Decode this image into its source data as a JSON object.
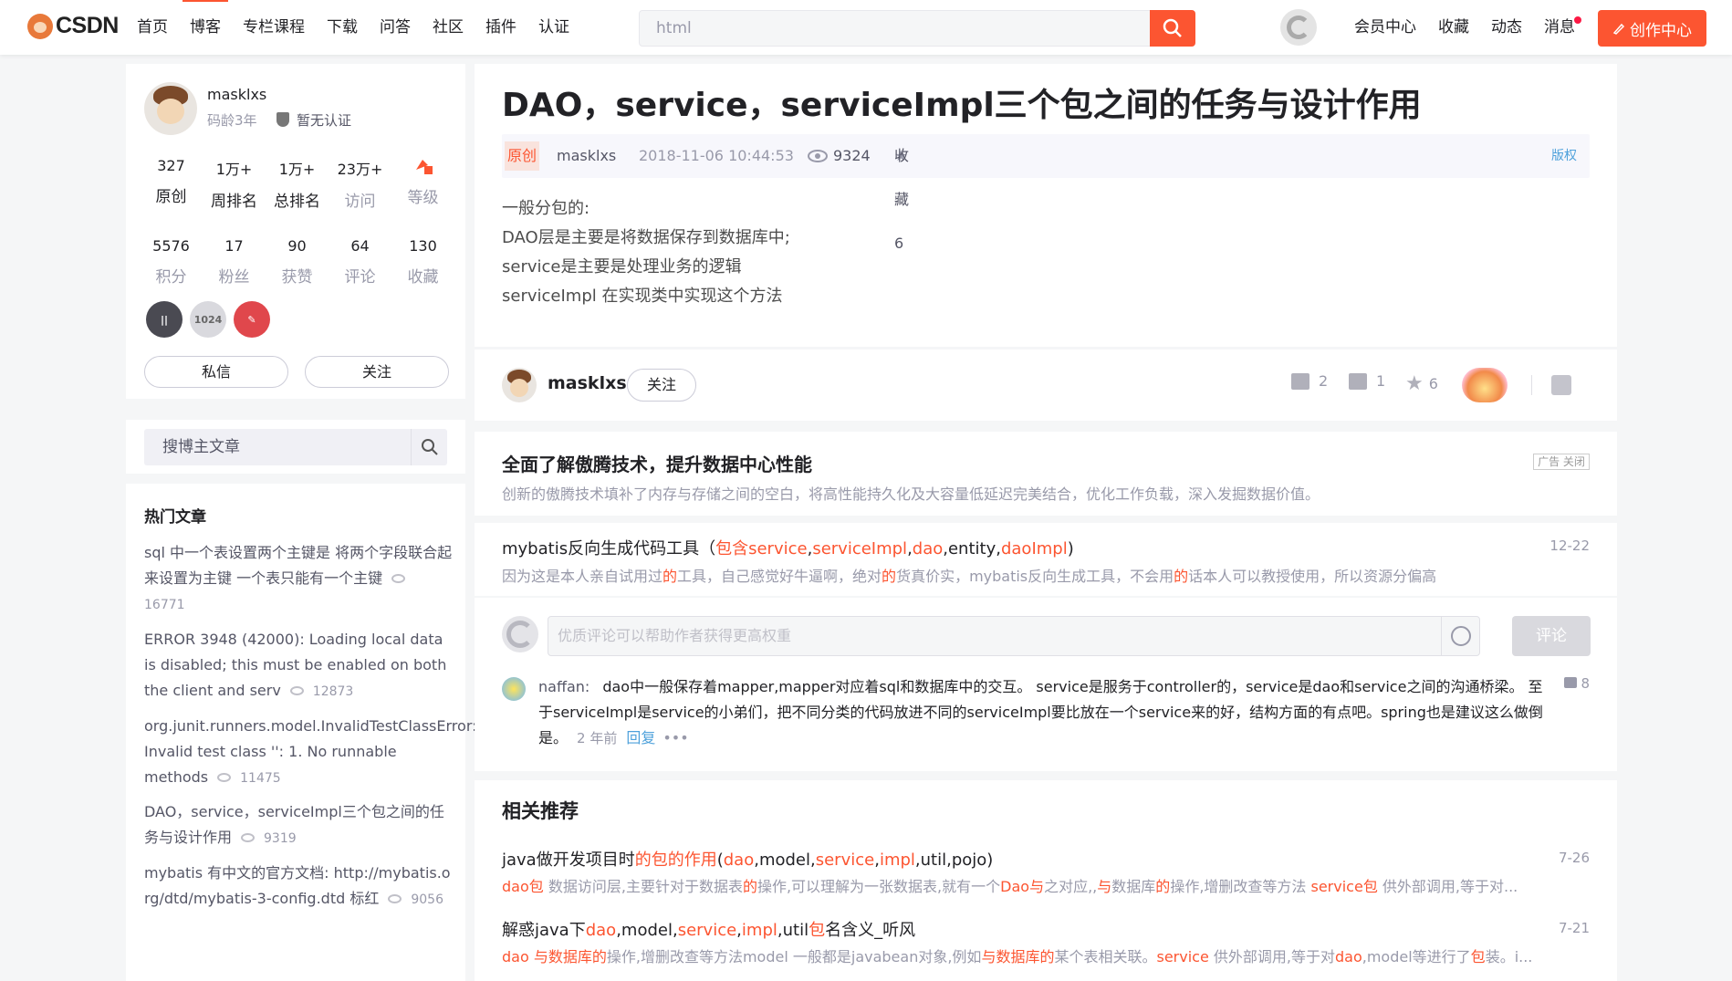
{
  "header": {
    "logo_text": "CSDN",
    "nav": [
      "首页",
      "博客",
      "专栏课程",
      "下载",
      "问答",
      "社区",
      "插件",
      "认证"
    ],
    "nav_active": "博客",
    "search_value": "html",
    "right_nav": [
      "会员中心",
      "收藏",
      "动态",
      "消息"
    ],
    "create_label": "创作中心",
    "accent": "#fc5531"
  },
  "profile": {
    "username": "masklxs",
    "age": "码龄3年",
    "verify": "暂无认证",
    "stats_row1": [
      {
        "value": "327",
        "label": "原创"
      },
      {
        "value": "1万+",
        "label": "周排名"
      },
      {
        "value": "1万+",
        "label": "总排名"
      },
      {
        "value": "23万+",
        "label": "访问"
      },
      {
        "value": "",
        "label": "等级"
      }
    ],
    "stats_row2": [
      {
        "value": "5576",
        "label": "积分"
      },
      {
        "value": "17",
        "label": "粉丝"
      },
      {
        "value": "90",
        "label": "获赞"
      },
      {
        "value": "64",
        "label": "评论"
      },
      {
        "value": "130",
        "label": "收藏"
      }
    ],
    "badge_1024": "1024",
    "message_btn": "私信",
    "follow_btn": "关注"
  },
  "blog_search": {
    "placeholder": "搜博主文章"
  },
  "hot": {
    "title": "热门文章",
    "items": [
      {
        "title": "sql 中一个表设置两个主键是 将两个字段联合起来设置为主键 一个表只能有一个主键",
        "views": "16771"
      },
      {
        "title": "ERROR 3948 (42000): Loading local data is disabled; this must be enabled on both the client and serv",
        "views": "12873"
      },
      {
        "title": "org.junit.runners.model.InvalidTestClassError: Invalid test class '': 1. No runnable methods",
        "views": "11475"
      },
      {
        "title": "DAO，service，serviceImpl三个包之间的任务与设计作用",
        "views": "9319"
      },
      {
        "title": "mybatis 有中文的官方文档: http://mybatis.org/dtd/mybatis-3-config.dtd 标红",
        "views": "9056"
      }
    ]
  },
  "article": {
    "title": "DAO，service，serviceImpl三个包之间的任务与设计作用",
    "original": "原创",
    "author": "masklxs",
    "datetime": "2018-11-06 10:44:53",
    "views": "9324",
    "favorites": "收藏 6",
    "copyright": "版权",
    "body": [
      "一般分包的:",
      "DAO层是主要是将数据保存到数据库中;",
      "service是主要是处理业务的逻辑",
      "serviceImpl 在实现类中实现这个方法"
    ]
  },
  "author_bar": {
    "name": "masklxs",
    "follow": "关注",
    "likes": "2",
    "comments": "1",
    "stars": "6"
  },
  "ad": {
    "title": "全面了解傲腾技术，提升数据中心性能",
    "desc": "创新的傲腾技术填补了内存与存储之间的空白，将高性能持久化及大容量低延迟完美结合，优化工作负载，深入发掘数据价值。",
    "tag": "广告 关闭"
  },
  "recommend_top": {
    "title_parts": [
      "mybatis反向生成代码工具（",
      "包含",
      "service",
      ",",
      "serviceImpl",
      ",",
      "dao",
      ",entity,",
      "daoImpl",
      ")"
    ],
    "date": "12-22",
    "desc_parts": [
      "因为这是本人亲自试用过",
      "的",
      "工具，自己感觉好牛逼啊，绝对",
      "的",
      "货真价实，mybatis反向生成工具，不会用",
      "的",
      "话本人可以教授使用，所以资源分偏高"
    ]
  },
  "comments": {
    "placeholder": "优质评论可以帮助作者获得更高权重",
    "submit": "评论",
    "item": {
      "user": "naffan:",
      "text": "dao中一般保存着mapper,mapper对应着sql和数据库中的交互。 service是服务于controller的，service是dao和service之间的沟通桥梁。 至于serviceImpl是service的小弟们，把不同分类的代码放进不同的serviceImpl要比放在一个service来的好，结构方面的有点吧。spring也是建议这么做倒是。",
      "time": "2 年前",
      "reply": "回复",
      "more": "•••",
      "likes": "8"
    }
  },
  "related": {
    "title": "相关推荐",
    "items": [
      {
        "title_parts": [
          "java做开发项目时",
          "的包的作用",
          "(",
          "dao",
          ",model,",
          "service",
          ",",
          "impl",
          ",util,pojo)"
        ],
        "date": "7-26",
        "desc_parts": [
          "dao包",
          " 数据访问层,主要针对于数据表",
          "的",
          "操作,可以理解为一张数据表,就有一个",
          "Dao与",
          "之对应,,",
          "与",
          "数据库",
          "的",
          "操作,增删改查等方法 ",
          "service包",
          " 供外部调用,等于对..."
        ]
      },
      {
        "title_parts": [
          "解惑java下",
          "dao",
          ",model,",
          "service",
          ",",
          "impl",
          ",util",
          "包",
          "名含义_听风"
        ],
        "date": "7-21",
        "desc_parts": [
          "dao 与",
          "数据库",
          "的",
          "操作,增删改查等方法model 一般都是javabean对象,例如",
          "与",
          "数据库",
          "的",
          "某个表相关联。",
          "service",
          " 供外部调用,等于对",
          "dao",
          ",model等进行了",
          "包",
          "装。i..."
        ]
      }
    ]
  }
}
